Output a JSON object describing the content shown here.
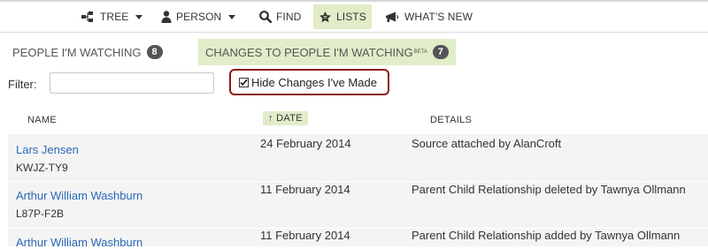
{
  "nav": {
    "tree": "TREE",
    "person": "PERSON",
    "find": "FIND",
    "lists": "LISTS",
    "whats_new": "WHAT'S NEW"
  },
  "tabs": {
    "watching": {
      "label": "PEOPLE I'M WATCHING",
      "count": "8"
    },
    "changes": {
      "label": "CHANGES TO PEOPLE I'M WATCHING",
      "beta": "BETA",
      "count": "7"
    }
  },
  "filter": {
    "label": "Filter:",
    "value": ""
  },
  "hide_changes": {
    "label": "Hide Changes I've Made",
    "checked": true
  },
  "table": {
    "headers": {
      "name": "NAME",
      "date": "DATE",
      "details": "DETAILS"
    },
    "sort_indicator": "↑",
    "rows": [
      {
        "name": "Lars Jensen",
        "id": "KWJZ-TY9",
        "date": "24 February 2014",
        "details": "Source attached by AlanCroft"
      },
      {
        "name": "Arthur William Washburn",
        "id": "L87P-F2B",
        "date": "11 February 2014",
        "details": "Parent Child Relationship deleted by Tawnya Ollmann"
      },
      {
        "name": "Arthur William Washburn",
        "id": "",
        "date": "11 February 2014",
        "details": "Parent Child Relationship added by Tawnya Ollmann"
      }
    ]
  },
  "colors": {
    "accent_bg": "#e1ecc9",
    "link": "#2b6ab7",
    "highlight_border": "#8b1a1a",
    "row_bg": "#f4f4f4"
  }
}
